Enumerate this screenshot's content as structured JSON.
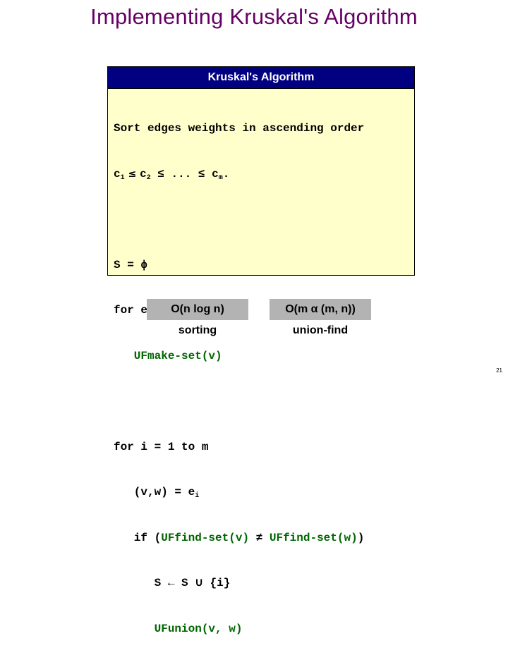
{
  "slide": {
    "title": "Implementing Kruskal's Algorithm",
    "page_number": "21"
  },
  "algorithm": {
    "header": "Kruskal's Algorithm",
    "lines": {
      "sort1": "Sort edges weights in ascending order",
      "sort2_c": "c",
      "sort2_sub1": "1",
      "sort2_le1": " ≤ ",
      "sort2_c2": "c",
      "sort2_sub2": "2",
      "sort2_le2": " ≤ ... ≤ ",
      "sort2_c3": "c",
      "sort2_subm": "m",
      "sort2_end": ".",
      "s_init": "S = ϕ",
      "foreach": "for each v ∈ V",
      "makeset": "   UFmake-set(v)",
      "fori": "for i = 1 to m",
      "assign": "   (v,w) = e",
      "assign_sub": "i",
      "if_prefix": "   if (",
      "find_v": "UFfind-set(v)",
      "neq": " ≠ ",
      "find_w": "UFfind-set(w)",
      "if_suffix": ")",
      "union_s": "      S ← S ∪ {i}",
      "ufunion": "      UFunion(v, w)"
    }
  },
  "complexity": [
    {
      "value": "O(n log n)",
      "label": "sorting"
    },
    {
      "value": "O(m α (m, n))",
      "label": "union-find"
    }
  ],
  "colors": {
    "title": "#660066",
    "header_bg": "#000080",
    "box_bg": "#ffffcc",
    "uf_calls": "#006600",
    "complexity_bg": "#b3b3b3"
  }
}
